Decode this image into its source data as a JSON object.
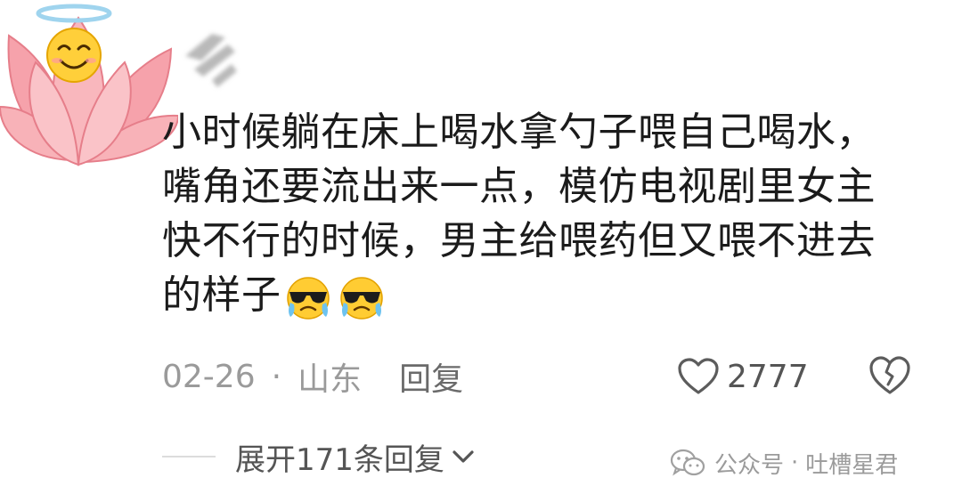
{
  "comment": {
    "text_lines": [
      "小时候躺在床上喝水拿勺子喂自己喝水，",
      "嘴角还要流出来一点，模仿电视剧里女主",
      "快不行的时候，男主给喂药但又喂不进去",
      "的样子"
    ],
    "trailing_emoji": [
      "cool-crying-emoji",
      "cool-crying-emoji"
    ],
    "date": "02-26",
    "separator": "·",
    "location": "山东",
    "reply_label": "回复",
    "like_count": "2777",
    "expand_replies_label": "展开171条回复"
  },
  "author": {
    "avatar_icon": "lotus-halo-smiley-avatar",
    "name_icon": "blurred-username"
  },
  "watermark": {
    "icon": "wechat-icon",
    "account_type": "公众号",
    "separator": "·",
    "account_name": "吐槽星君"
  },
  "colors": {
    "text_primary": "#1b1b1b",
    "text_meta": "#9a9a9a",
    "text_action": "#555555",
    "lotus_pink": "#f7a5ad",
    "halo_blue": "#a8d8ee",
    "emoji_yellow": "#ffcc33"
  },
  "icons": {
    "like": "heart-outline-icon",
    "dislike": "broken-heart-icon",
    "expand": "chevron-down-icon"
  }
}
